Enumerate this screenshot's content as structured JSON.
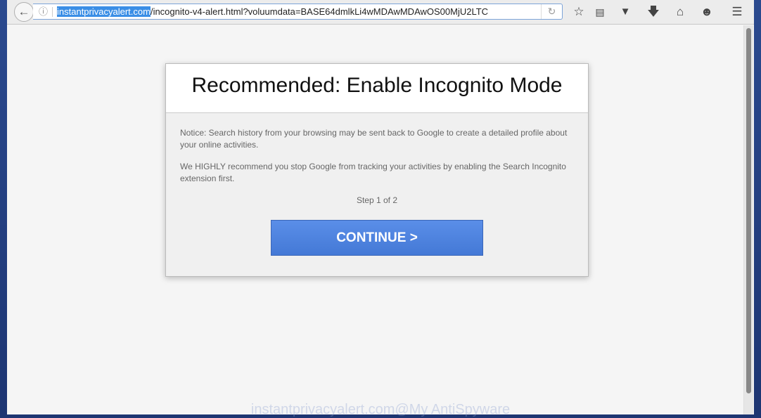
{
  "browser": {
    "url_host": "instantprivacyalert.com",
    "url_rest": "/incognito-v4-alert.html?voluumdata=BASE64dmlkLi4wMDAwMDAwOS00MjU2LTC",
    "icons": [
      "back-icon",
      "info-icon",
      "reload-icon",
      "star-icon",
      "reading-list-icon",
      "pocket-icon",
      "download-icon",
      "home-icon",
      "chat-icon",
      "menu-icon"
    ]
  },
  "dialog": {
    "title": "Recommended: Enable Incognito Mode",
    "notice": "Notice: Search history from your browsing may be sent back to Google to create a detailed profile about your online activities.",
    "recommend": "We HIGHLY recommend you stop Google from tracking your activities by enabling the Search Incognito extension first.",
    "step": "Step 1 of 2",
    "continue_label": "CONTINUE >",
    "button_color": "#4a80dd"
  },
  "watermark": "instantprivacyalert.com@My AntiSpyware"
}
